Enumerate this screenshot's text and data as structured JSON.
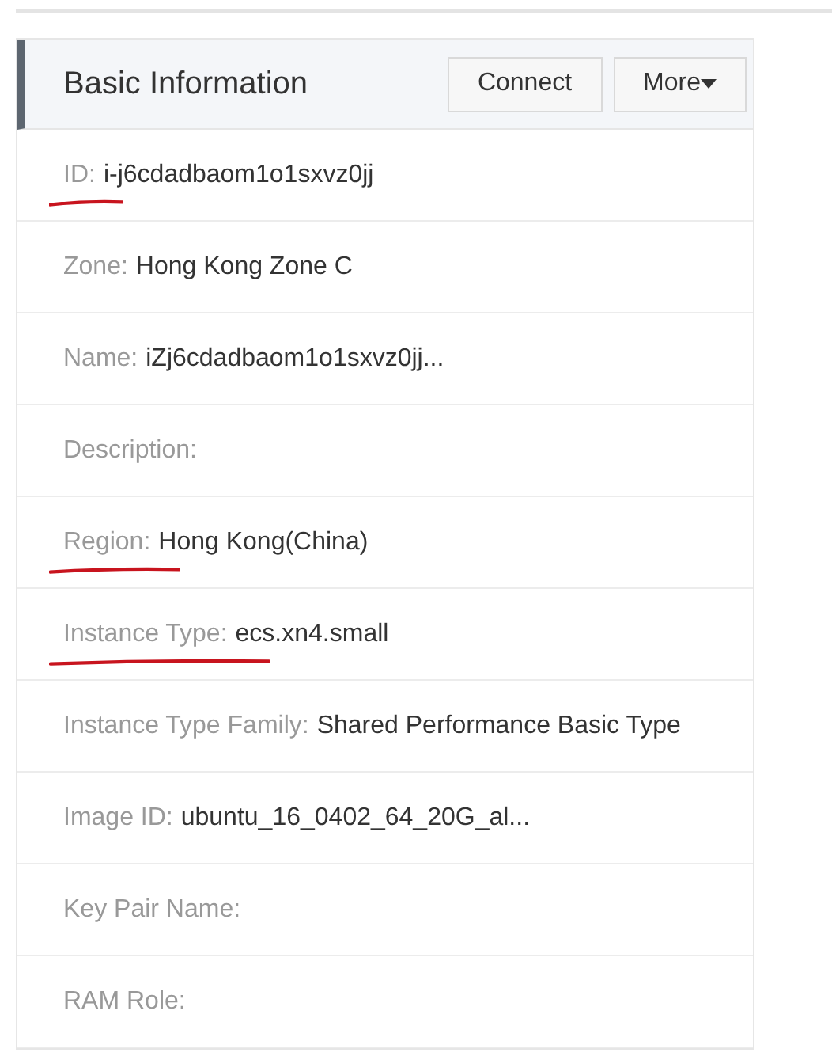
{
  "panel": {
    "title": "Basic Information",
    "buttons": [
      {
        "label": "Connect",
        "dropdown": false
      },
      {
        "label": "More",
        "dropdown": true
      }
    ]
  },
  "rows": [
    {
      "label": "ID:",
      "value": "i-j6cdadbaom1o1sxvz0jj",
      "underlined": true
    },
    {
      "label": "Zone:",
      "value": "Hong Kong Zone C",
      "underlined": false
    },
    {
      "label": "Name:",
      "value": "iZj6cdadbaom1o1sxvz0jj...",
      "underlined": false
    },
    {
      "label": "Description:",
      "underlined": false
    },
    {
      "label": "Region:",
      "value": "Hong Kong(China)",
      "underlined": true
    },
    {
      "label": "Instance Type:",
      "value": "ecs.xn4.small",
      "underlined": true
    },
    {
      "label": "Instance Type Family:",
      "value": "Shared Performance Basic Type",
      "underlined": false
    },
    {
      "label": "Image ID:",
      "value": "ubuntu_16_0402_64_20G_al...",
      "underlined": false
    },
    {
      "label": "Key Pair Name:",
      "underlined": false
    },
    {
      "label": "RAM Role:",
      "underlined": false
    }
  ]
}
